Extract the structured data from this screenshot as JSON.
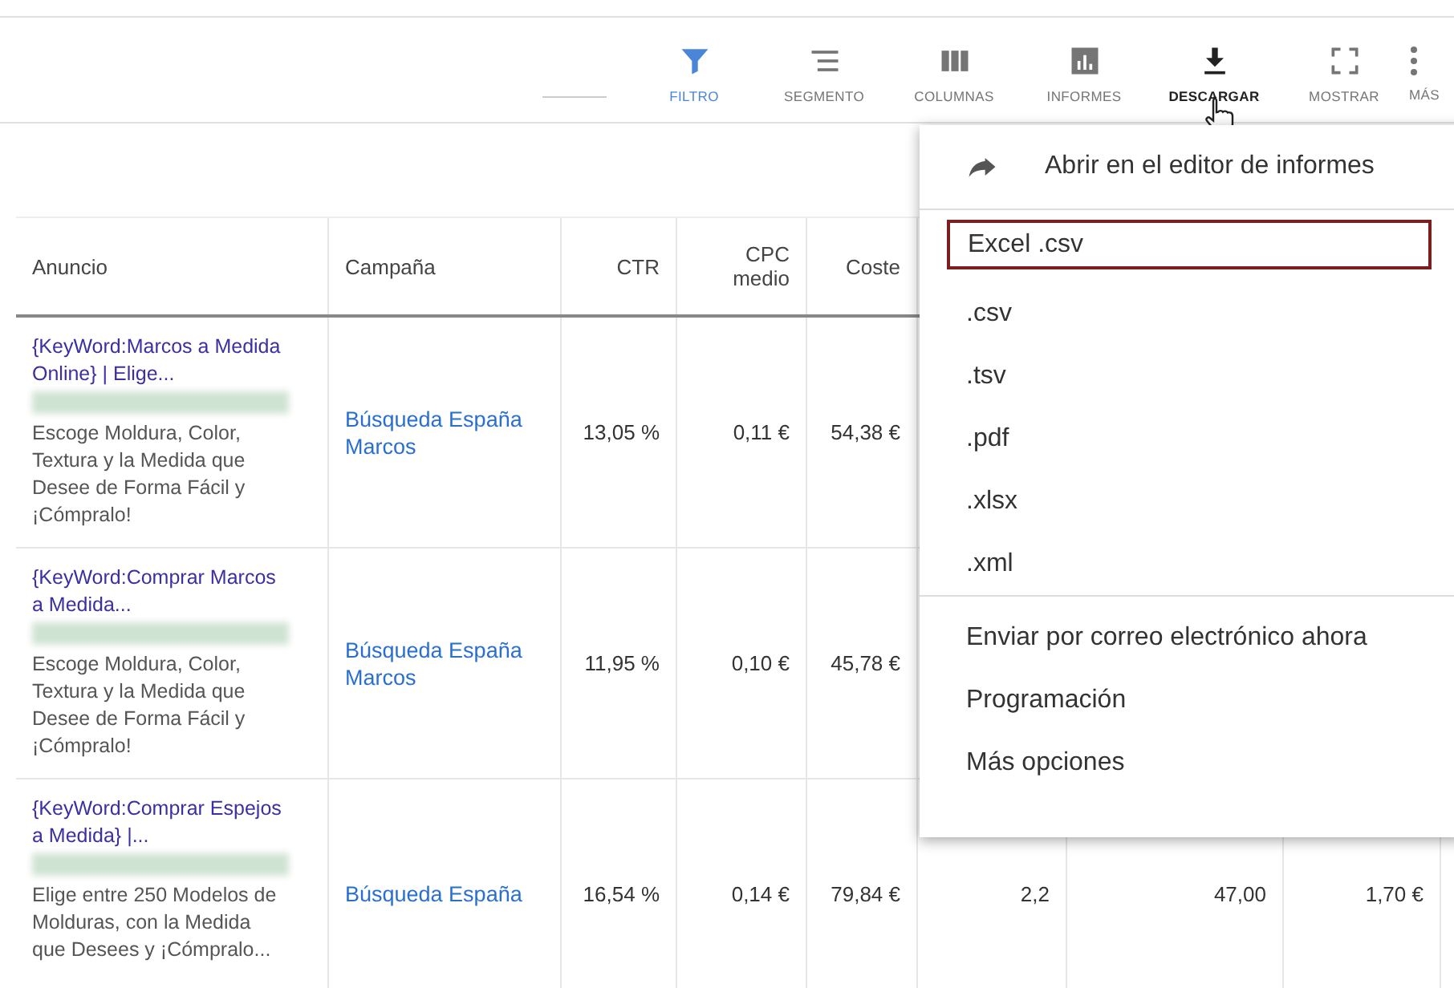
{
  "toolbar": [
    {
      "kind": "filter",
      "label": "FILTRO",
      "selected": true,
      "hovered": false
    },
    {
      "kind": "segment",
      "label": "SEGMENTO",
      "selected": false,
      "hovered": false
    },
    {
      "kind": "columns",
      "label": "COLUMNAS",
      "selected": false,
      "hovered": false
    },
    {
      "kind": "reports",
      "label": "INFORMES",
      "selected": false,
      "hovered": false
    },
    {
      "kind": "download",
      "label": "DESCARGAR",
      "selected": false,
      "hovered": true
    },
    {
      "kind": "expand",
      "label": "MOSTRAR",
      "selected": false,
      "hovered": false
    },
    {
      "kind": "more",
      "label": "MÁS",
      "selected": false,
      "hovered": false
    }
  ],
  "table": {
    "columns": [
      "Anuncio",
      "Campaña",
      "CTR",
      "CPC medio",
      "Coste"
    ],
    "rows": [
      {
        "title": "{KeyWord:Marcos a Medida Online} | Elige...",
        "description": "Escoge Moldura, Color, Textura y la Medida que Desee de Forma Fácil y ¡Cómpralo!",
        "campaign": "Búsqueda España Marcos",
        "ctr": "13,05 %",
        "cpc": "0,11 €",
        "cost": "54,38 €"
      },
      {
        "title": "{KeyWord:Comprar Marcos a Medida...",
        "description": "Escoge Moldura, Color, Textura y la Medida que Desee de Forma Fácil y ¡Cómpralo!",
        "campaign": "Búsqueda España Marcos",
        "ctr": "11,95 %",
        "cpc": "0,10 €",
        "cost": "45,78 €"
      },
      {
        "title": "{KeyWord:Comprar Espejos a Medida} |...",
        "description": "Elige entre 250 Modelos de Molduras, con la Medida que Desees y ¡Cómpralo...",
        "campaign": "Búsqueda España",
        "ctr": "16,54 %",
        "cpc": "0,14 €",
        "cost": "79,84 €",
        "column_6": "2,2",
        "column_7": "47,00",
        "column_8": "1,70 €"
      }
    ]
  },
  "download_menu": {
    "open_in_editor": "Abrir en el editor de informes",
    "formats": [
      {
        "label": "Excel .csv",
        "selected": true
      },
      {
        "label": ".csv",
        "selected": false
      },
      {
        "label": ".tsv",
        "selected": false
      },
      {
        "label": ".pdf",
        "selected": false
      },
      {
        "label": ".xlsx",
        "selected": false
      },
      {
        "label": ".xml",
        "selected": false
      }
    ],
    "actions": [
      "Enviar por correo electrónico ahora",
      "Programación",
      "Más opciones"
    ]
  }
}
